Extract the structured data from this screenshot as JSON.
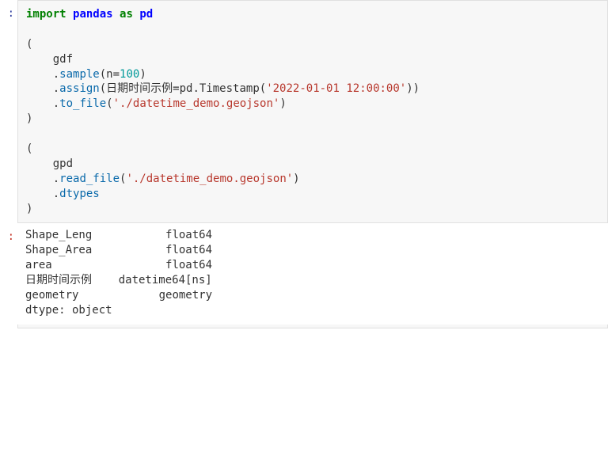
{
  "input_cell": {
    "prompt": ":",
    "line1": {
      "kw1": "import",
      "mod": "pandas",
      "kw2": "as",
      "alias": "pd"
    },
    "line3_open": "(",
    "line4_gdf": "    gdf",
    "line5": {
      "indent": "    .",
      "fn": "sample",
      "open": "(",
      "arg": "n",
      "eq": "=",
      "val": "100",
      "close": ")"
    },
    "line6": {
      "indent": "    .",
      "fn": "assign",
      "open": "(",
      "arg": "日期时间示例",
      "eq": "=",
      "pd": "pd.Timestamp",
      "open2": "(",
      "str": "'2022-01-01 12:00:00'",
      "close2": ")",
      "close": ")"
    },
    "line7": {
      "indent": "    .",
      "fn": "to_file",
      "open": "(",
      "str": "'./datetime_demo.geojson'",
      "close": ")"
    },
    "line8_close": ")",
    "line10_open": "(",
    "line11_gpd": "    gpd",
    "line12": {
      "indent": "    .",
      "fn": "read_file",
      "open": "(",
      "str": "'./datetime_demo.geojson'",
      "close": ")"
    },
    "line13": {
      "indent": "    .",
      "attr": "dtypes"
    },
    "line14_close": ")"
  },
  "output_cell": {
    "prompt": ":",
    "rows": [
      {
        "name": "Shape_Leng",
        "type": "float64"
      },
      {
        "name": "Shape_Area",
        "type": "float64"
      },
      {
        "name": "area",
        "type": "float64"
      },
      {
        "name": "日期时间示例",
        "type": "datetime64[ns]"
      },
      {
        "name": "geometry",
        "type": "geometry"
      }
    ],
    "footer": "dtype: object"
  }
}
